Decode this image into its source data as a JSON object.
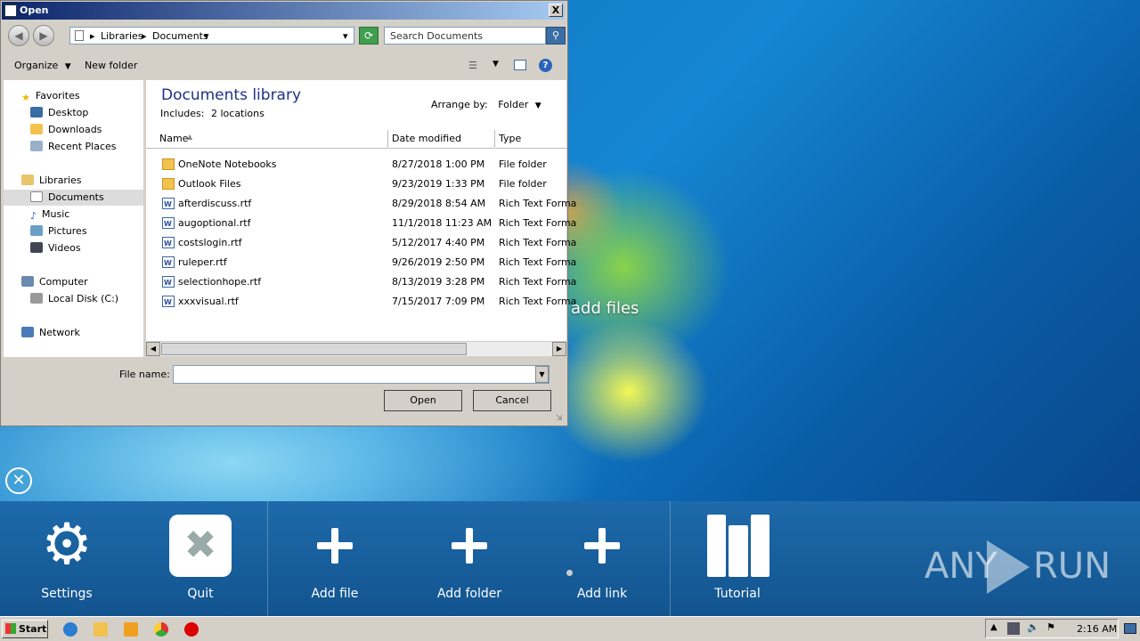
{
  "dialog": {
    "title": "Open",
    "close_label": "X",
    "breadcrumb": [
      "Libraries",
      "Documents"
    ],
    "search_placeholder": "Search Documents",
    "toolbar": {
      "organize": "Organize",
      "new_folder": "New folder",
      "help": "?"
    },
    "nav": {
      "favorites": "Favorites",
      "fav_items": [
        "Desktop",
        "Downloads",
        "Recent Places"
      ],
      "libraries": "Libraries",
      "lib_items": [
        "Documents",
        "Music",
        "Pictures",
        "Videos"
      ],
      "computer": "Computer",
      "computer_items": [
        "Local Disk (C:)"
      ],
      "network": "Network"
    },
    "library": {
      "title": "Documents library",
      "includes_label": "Includes:",
      "includes_link": "2 locations",
      "arrange_label": "Arrange by:",
      "arrange_value": "Folder"
    },
    "columns": {
      "name": "Name",
      "date": "Date modified",
      "type": "Type"
    },
    "files": [
      {
        "name": "OneNote Notebooks",
        "date": "8/27/2018 1:00 PM",
        "type": "File folder",
        "icon": "folder"
      },
      {
        "name": "Outlook Files",
        "date": "9/23/2019 1:33 PM",
        "type": "File folder",
        "icon": "folder"
      },
      {
        "name": "afterdiscuss.rtf",
        "date": "8/29/2018 8:54 AM",
        "type": "Rich Text Forma",
        "icon": "rtf"
      },
      {
        "name": "augoptional.rtf",
        "date": "11/1/2018 11:23 AM",
        "type": "Rich Text Forma",
        "icon": "rtf"
      },
      {
        "name": "costslogin.rtf",
        "date": "5/12/2017 4:40 PM",
        "type": "Rich Text Forma",
        "icon": "rtf"
      },
      {
        "name": "ruleper.rtf",
        "date": "9/26/2019 2:50 PM",
        "type": "Rich Text Forma",
        "icon": "rtf"
      },
      {
        "name": "selectionhope.rtf",
        "date": "8/13/2019 3:28 PM",
        "type": "Rich Text Forma",
        "icon": "rtf"
      },
      {
        "name": "xxxvisual.rtf",
        "date": "7/15/2017 7:09 PM",
        "type": "Rich Text Forma",
        "icon": "rtf"
      }
    ],
    "filename_label": "File name:",
    "filename_value": "",
    "open_button": "Open",
    "cancel_button": "Cancel"
  },
  "app": {
    "drop_hint": "add files",
    "tiles": {
      "settings": "Settings",
      "quit": "Quit",
      "add_file": "Add file",
      "add_folder": "Add folder",
      "add_link": "Add link",
      "tutorial": "Tutorial"
    },
    "watermark_left": "ANY",
    "watermark_right": "RUN"
  },
  "taskbar": {
    "start": "Start",
    "clock": "2:16 AM",
    "icons": [
      "ie-icon",
      "explorer-icon",
      "media-player-icon",
      "chrome-icon",
      "antivirus-icon"
    ]
  },
  "colors": {
    "panel": "#1a62a3",
    "selection": "#dcdcdc",
    "accent": "#0a246a"
  }
}
